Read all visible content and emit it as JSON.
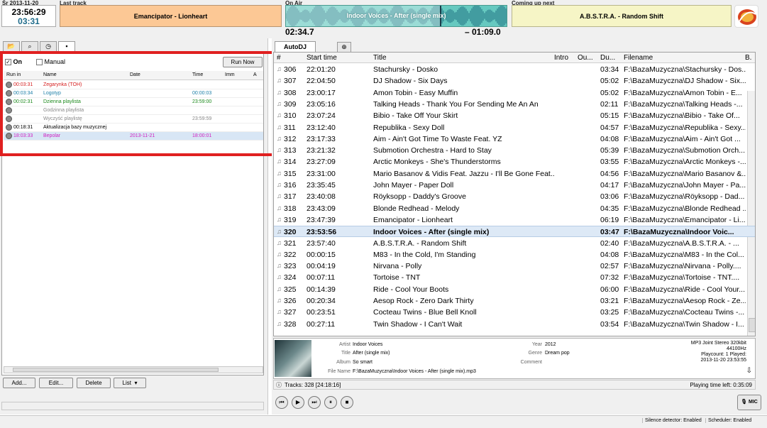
{
  "header": {
    "date": "Śr 2013-11-20",
    "clock": "23:56:29",
    "clock_remaining": "03:31",
    "last_track_label": "Last track",
    "last_track": "Emancipator - Lionheart",
    "on_air_label": "On Air",
    "on_air_track": "Indoor Voices - After (single mix)",
    "elapsed": "02:34.7",
    "remaining": "– 01:09.0",
    "next_label": "Coming up next",
    "next_track": "A.B.S.T.R.A. - Random Shift",
    "progress_fraction": 0.7,
    "colors": {
      "last": "#fcc895",
      "onair": "#66c9c0",
      "next": "#f6f5c6"
    }
  },
  "left_tabs": [
    "folder-icon",
    "search-icon",
    "clock-icon",
    "display-icon"
  ],
  "scheduler": {
    "on_label": "On",
    "manual_label": "Manual",
    "run_now": "Run Now",
    "columns": [
      "Run in",
      "Name",
      "Date",
      "Time",
      "Imm",
      "A"
    ],
    "rows": [
      {
        "run_in": "00:03:31",
        "name": "Zegarynka (TOH)",
        "date": "",
        "time": "",
        "color": "#d62020"
      },
      {
        "run_in": "00:03:34",
        "name": "Logotyp",
        "date": "",
        "time": "00:00:03",
        "color": "#1d7fa8"
      },
      {
        "run_in": "00:02:31",
        "name": "Dzienna playlista",
        "date": "",
        "time": "23:59:00",
        "color": "#1d8a1d"
      },
      {
        "run_in": "",
        "name": "Godzinna playlista",
        "date": "",
        "time": "",
        "color": "#888888"
      },
      {
        "run_in": "",
        "name": "Wyczyść playlistę",
        "date": "",
        "time": "23:59:59",
        "color": "#888888"
      },
      {
        "run_in": "00:18:31",
        "name": "Aktualizacja bazy muzycznej",
        "date": "",
        "time": "",
        "color": "#000000"
      },
      {
        "run_in": "18:03:33",
        "name": "Bepolar",
        "date": "2013-11-21",
        "time": "18:00:01",
        "color": "#d020c0"
      }
    ],
    "buttons": [
      "Add...",
      "Edit...",
      "Delete",
      "List"
    ]
  },
  "playlist": {
    "tab": "AutoDJ",
    "columns": [
      "#",
      "Start time",
      "Title",
      "Intro",
      "Ou...",
      "Du...",
      "Filename",
      "B."
    ],
    "rows": [
      {
        "n": "306",
        "start": "22:01:20",
        "title": "Stachursky - Dosko",
        "dur": "03:34",
        "file": "F:\\BazaMuzyczna\\Stachursky - Dos..."
      },
      {
        "n": "307",
        "start": "22:04:50",
        "title": "DJ Shadow - Six Days",
        "dur": "05:02",
        "file": "F:\\BazaMuzyczna\\DJ Shadow - Six..."
      },
      {
        "n": "308",
        "start": "23:00:17",
        "title": "Amon Tobin - Easy Muffin",
        "dur": "05:02",
        "file": "F:\\BazaMuzyczna\\Amon Tobin - E..."
      },
      {
        "n": "309",
        "start": "23:05:16",
        "title": "Talking Heads - Thank You For Sending Me An An",
        "dur": "02:11",
        "file": "F:\\BazaMuzyczna\\Talking Heads -..."
      },
      {
        "n": "310",
        "start": "23:07:24",
        "title": "Bibio - Take Off Your Skirt",
        "dur": "05:15",
        "file": "F:\\BazaMuzyczna\\Bibio - Take Of..."
      },
      {
        "n": "311",
        "start": "23:12:40",
        "title": "Republika - Sexy Doll",
        "dur": "04:57",
        "file": "F:\\BazaMuzyczna\\Republika - Sexy..."
      },
      {
        "n": "312",
        "start": "23:17:33",
        "title": "Aim - Ain't Got Time To Waste Feat. YZ",
        "dur": "04:08",
        "file": "F:\\BazaMuzyczna\\Aim - Ain't Got ..."
      },
      {
        "n": "313",
        "start": "23:21:32",
        "title": "Submotion Orchestra - Hard to Stay",
        "dur": "05:39",
        "file": "F:\\BazaMuzyczna\\Submotion Orch..."
      },
      {
        "n": "314",
        "start": "23:27:09",
        "title": "Arctic Monkeys - She's Thunderstorms",
        "dur": "03:55",
        "file": "F:\\BazaMuzyczna\\Arctic Monkeys -..."
      },
      {
        "n": "315",
        "start": "23:31:00",
        "title": "Mario Basanov & Vidis Feat. Jazzu - I'll Be Gone Feat...",
        "dur": "04:56",
        "file": "F:\\BazaMuzyczna\\Mario Basanov &..."
      },
      {
        "n": "316",
        "start": "23:35:45",
        "title": "John Mayer - Paper Doll",
        "dur": "04:17",
        "file": "F:\\BazaMuzyczna\\John Mayer - Pa..."
      },
      {
        "n": "317",
        "start": "23:40:08",
        "title": "Röyksopp - Daddy's Groove",
        "dur": "03:06",
        "file": "F:\\BazaMuzyczna\\Röyksopp - Dad..."
      },
      {
        "n": "318",
        "start": "23:43:09",
        "title": "Blonde Redhead - Melody",
        "dur": "04:35",
        "file": "F:\\BazaMuzyczna\\Blonde Redhead ..."
      },
      {
        "n": "319",
        "start": "23:47:39",
        "title": "Emancipator - Lionheart",
        "dur": "06:19",
        "file": "F:\\BazaMuzyczna\\Emancipator - Li..."
      },
      {
        "n": "320",
        "start": "23:53:56",
        "title": "Indoor Voices - After (single mix)",
        "dur": "03:47",
        "file": "F:\\BazaMuzyczna\\Indoor Voic..."
      },
      {
        "n": "321",
        "start": "23:57:40",
        "title": "A.B.S.T.R.A. - Random Shift",
        "dur": "02:40",
        "file": "F:\\BazaMuzyczna\\A.B.S.T.R.A. - ..."
      },
      {
        "n": "322",
        "start": "00:00:15",
        "title": "M83 - In the Cold, I'm Standing",
        "dur": "04:08",
        "file": "F:\\BazaMuzyczna\\M83 - In the Col..."
      },
      {
        "n": "323",
        "start": "00:04:19",
        "title": "Nirvana - Polly",
        "dur": "02:57",
        "file": "F:\\BazaMuzyczna\\Nirvana - Polly...."
      },
      {
        "n": "324",
        "start": "00:07:11",
        "title": "Tortoise - TNT",
        "dur": "07:32",
        "file": "F:\\BazaMuzyczna\\Tortoise - TNT...."
      },
      {
        "n": "325",
        "start": "00:14:39",
        "title": "Ride - Cool Your Boots",
        "dur": "06:00",
        "file": "F:\\BazaMuzyczna\\Ride - Cool Your..."
      },
      {
        "n": "326",
        "start": "00:20:34",
        "title": "Aesop Rock - Zero Dark Thirty",
        "dur": "03:21",
        "file": "F:\\BazaMuzyczna\\Aesop Rock - Ze..."
      },
      {
        "n": "327",
        "start": "00:23:51",
        "title": "Cocteau Twins - Blue Bell Knoll",
        "dur": "03:25",
        "file": "F:\\BazaMuzyczna\\Cocteau Twins -..."
      },
      {
        "n": "328",
        "start": "00:27:11",
        "title": "Twin Shadow - I Can't Wait",
        "dur": "03:54",
        "file": "F:\\BazaMuzyczna\\Twin Shadow - I..."
      }
    ]
  },
  "info": {
    "artist_label": "Artist",
    "artist": "Indoor Voices",
    "title_label": "Title",
    "title": "After (single mix)",
    "album_label": "Album",
    "album": "So smart",
    "year_label": "Year",
    "year": "2012",
    "genre_label": "Genre",
    "genre": "Dream pop",
    "comment_label": "Comment",
    "filename_label": "File Name",
    "filename": "F:\\BazaMuzyczna\\Indoor Voices - After (single mix).mp3",
    "format": "MP3 Joint Stereo 320kbit",
    "samplerate": "44100Hz",
    "playcount": "Playcount: 1 Played:",
    "played_at": "2013-11-20 23:53:55"
  },
  "status": {
    "tracks": "Tracks: 328 [24:18:16]",
    "time_left": "Playing time left: 0:35:09",
    "mic": "MIC",
    "silence": "Silence detector: Enabled",
    "scheduler": "Scheduler: Enabled"
  }
}
